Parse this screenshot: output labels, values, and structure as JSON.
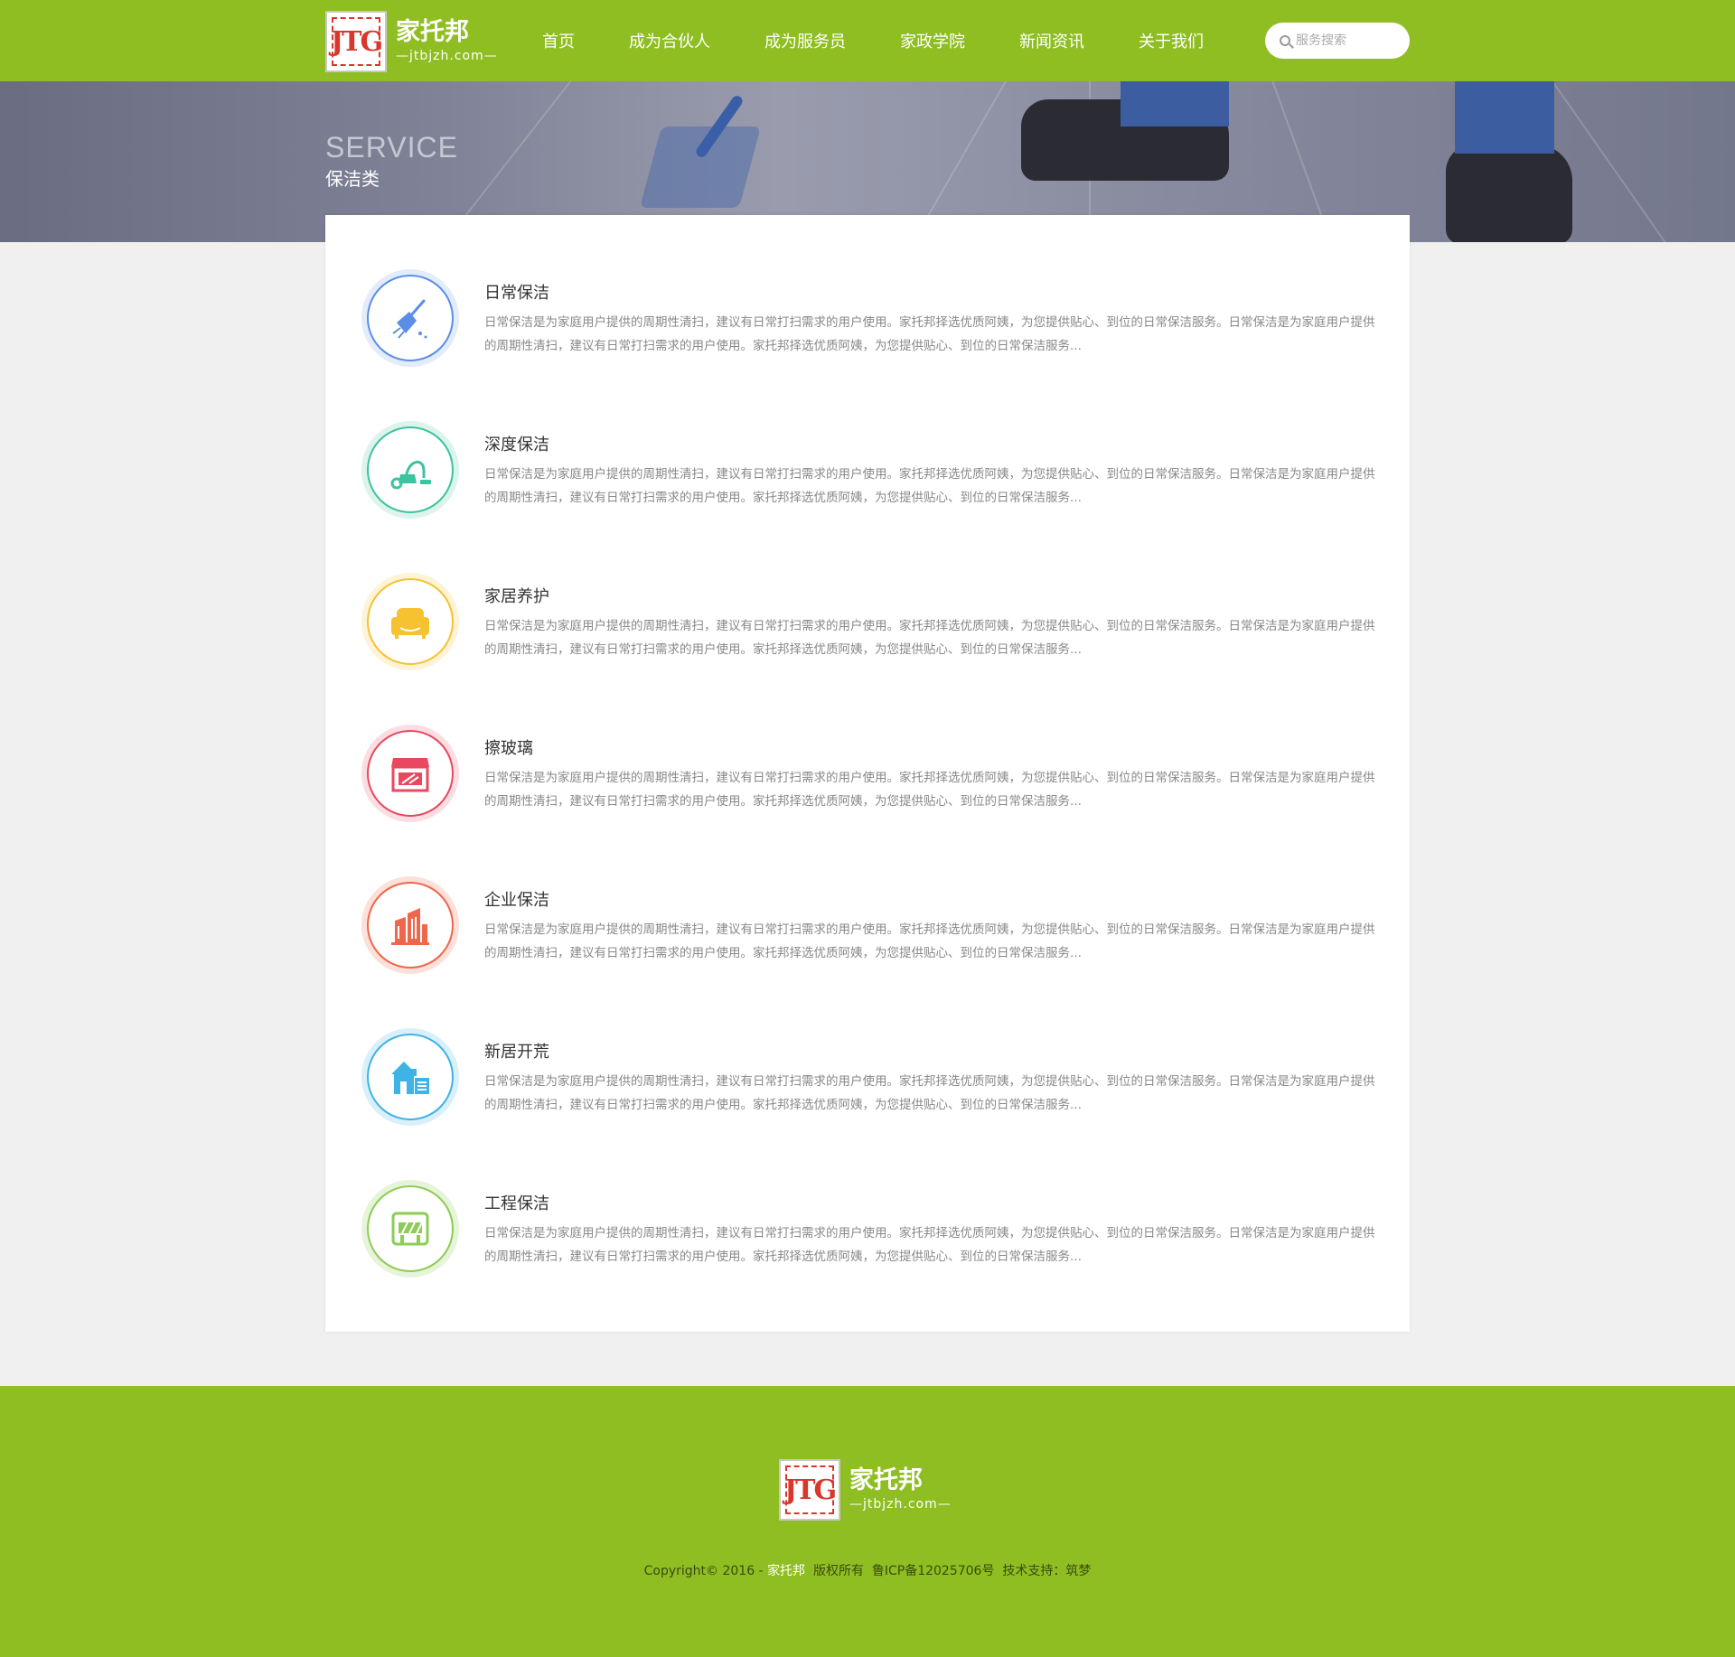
{
  "header": {
    "logo_glyph": "JTG",
    "logo_cn": "家托邦",
    "logo_en": "—jtbjzh.com—",
    "nav": [
      "首页",
      "成为合伙人",
      "成为服务员",
      "家政学院",
      "新闻资讯",
      "关于我们"
    ],
    "search_placeholder": "服务搜索"
  },
  "banner": {
    "title": "SERVICE",
    "subtitle": "保洁类"
  },
  "services": [
    {
      "title": "日常保洁",
      "icon": "broom-icon",
      "color": "#5b8ee6",
      "ring": "#e3ecfb",
      "desc": "日常保洁是为家庭用户提供的周期性清扫，建议有日常打扫需求的用户使用。家托邦择选优质阿姨，为您提供贴心、到位的日常保洁服务。日常保洁是为家庭用户提供的周期性清扫，建议有日常打扫需求的用户使用。家托邦择选优质阿姨，为您提供贴心、到位的日常保洁服务..."
    },
    {
      "title": "深度保洁",
      "icon": "vacuum-cleaner-icon",
      "color": "#3cc3a0",
      "ring": "#dcf4ec",
      "desc": "日常保洁是为家庭用户提供的周期性清扫，建议有日常打扫需求的用户使用。家托邦择选优质阿姨，为您提供贴心、到位的日常保洁服务。日常保洁是为家庭用户提供的周期性清扫，建议有日常打扫需求的用户使用。家托邦择选优质阿姨，为您提供贴心、到位的日常保洁服务..."
    },
    {
      "title": "家居养护",
      "icon": "sofa-icon",
      "color": "#f7c230",
      "ring": "#fdf3d6",
      "desc": "日常保洁是为家庭用户提供的周期性清扫，建议有日常打扫需求的用户使用。家托邦择选优质阿姨，为您提供贴心、到位的日常保洁服务。日常保洁是为家庭用户提供的周期性清扫，建议有日常打扫需求的用户使用。家托邦择选优质阿姨，为您提供贴心、到位的日常保洁服务..."
    },
    {
      "title": "擦玻璃",
      "icon": "storefront-window-icon",
      "color": "#e8495f",
      "ring": "#fbdde2",
      "desc": "日常保洁是为家庭用户提供的周期性清扫，建议有日常打扫需求的用户使用。家托邦择选优质阿姨，为您提供贴心、到位的日常保洁服务。日常保洁是为家庭用户提供的周期性清扫，建议有日常打扫需求的用户使用。家托邦择选优质阿姨，为您提供贴心、到位的日常保洁服务..."
    },
    {
      "title": "企业保洁",
      "icon": "office-building-icon",
      "color": "#f0664a",
      "ring": "#fce0d9",
      "desc": "日常保洁是为家庭用户提供的周期性清扫，建议有日常打扫需求的用户使用。家托邦择选优质阿姨，为您提供贴心、到位的日常保洁服务。日常保洁是为家庭用户提供的周期性清扫，建议有日常打扫需求的用户使用。家托邦择选优质阿姨，为您提供贴心、到位的日常保洁服务..."
    },
    {
      "title": "新居开荒",
      "icon": "house-icon",
      "color": "#3fb3e6",
      "ring": "#d9f0fa",
      "desc": "日常保洁是为家庭用户提供的周期性清扫，建议有日常打扫需求的用户使用。家托邦择选优质阿姨，为您提供贴心、到位的日常保洁服务。日常保洁是为家庭用户提供的周期性清扫，建议有日常打扫需求的用户使用。家托邦择选优质阿姨，为您提供贴心、到位的日常保洁服务..."
    },
    {
      "title": "工程保洁",
      "icon": "construction-barrier-icon",
      "color": "#8dcc55",
      "ring": "#e6f4d9",
      "desc": "日常保洁是为家庭用户提供的周期性清扫，建议有日常打扫需求的用户使用。家托邦择选优质阿姨，为您提供贴心、到位的日常保洁服务。日常保洁是为家庭用户提供的周期性清扫，建议有日常打扫需求的用户使用。家托邦择选优质阿姨，为您提供贴心、到位的日常保洁服务..."
    }
  ],
  "footer": {
    "logo_glyph": "JTG",
    "logo_cn": "家托邦",
    "logo_en": "—jtbjzh.com—",
    "copy_prefix": "Copyright© 2016 - ",
    "copy_brand": "家托邦",
    "copy_suffix": "  版权所有  鲁ICP备12025706号  技术支持：筑梦"
  },
  "colors": {
    "brand_green": "#8fbe22",
    "logo_red": "#d9362c"
  }
}
